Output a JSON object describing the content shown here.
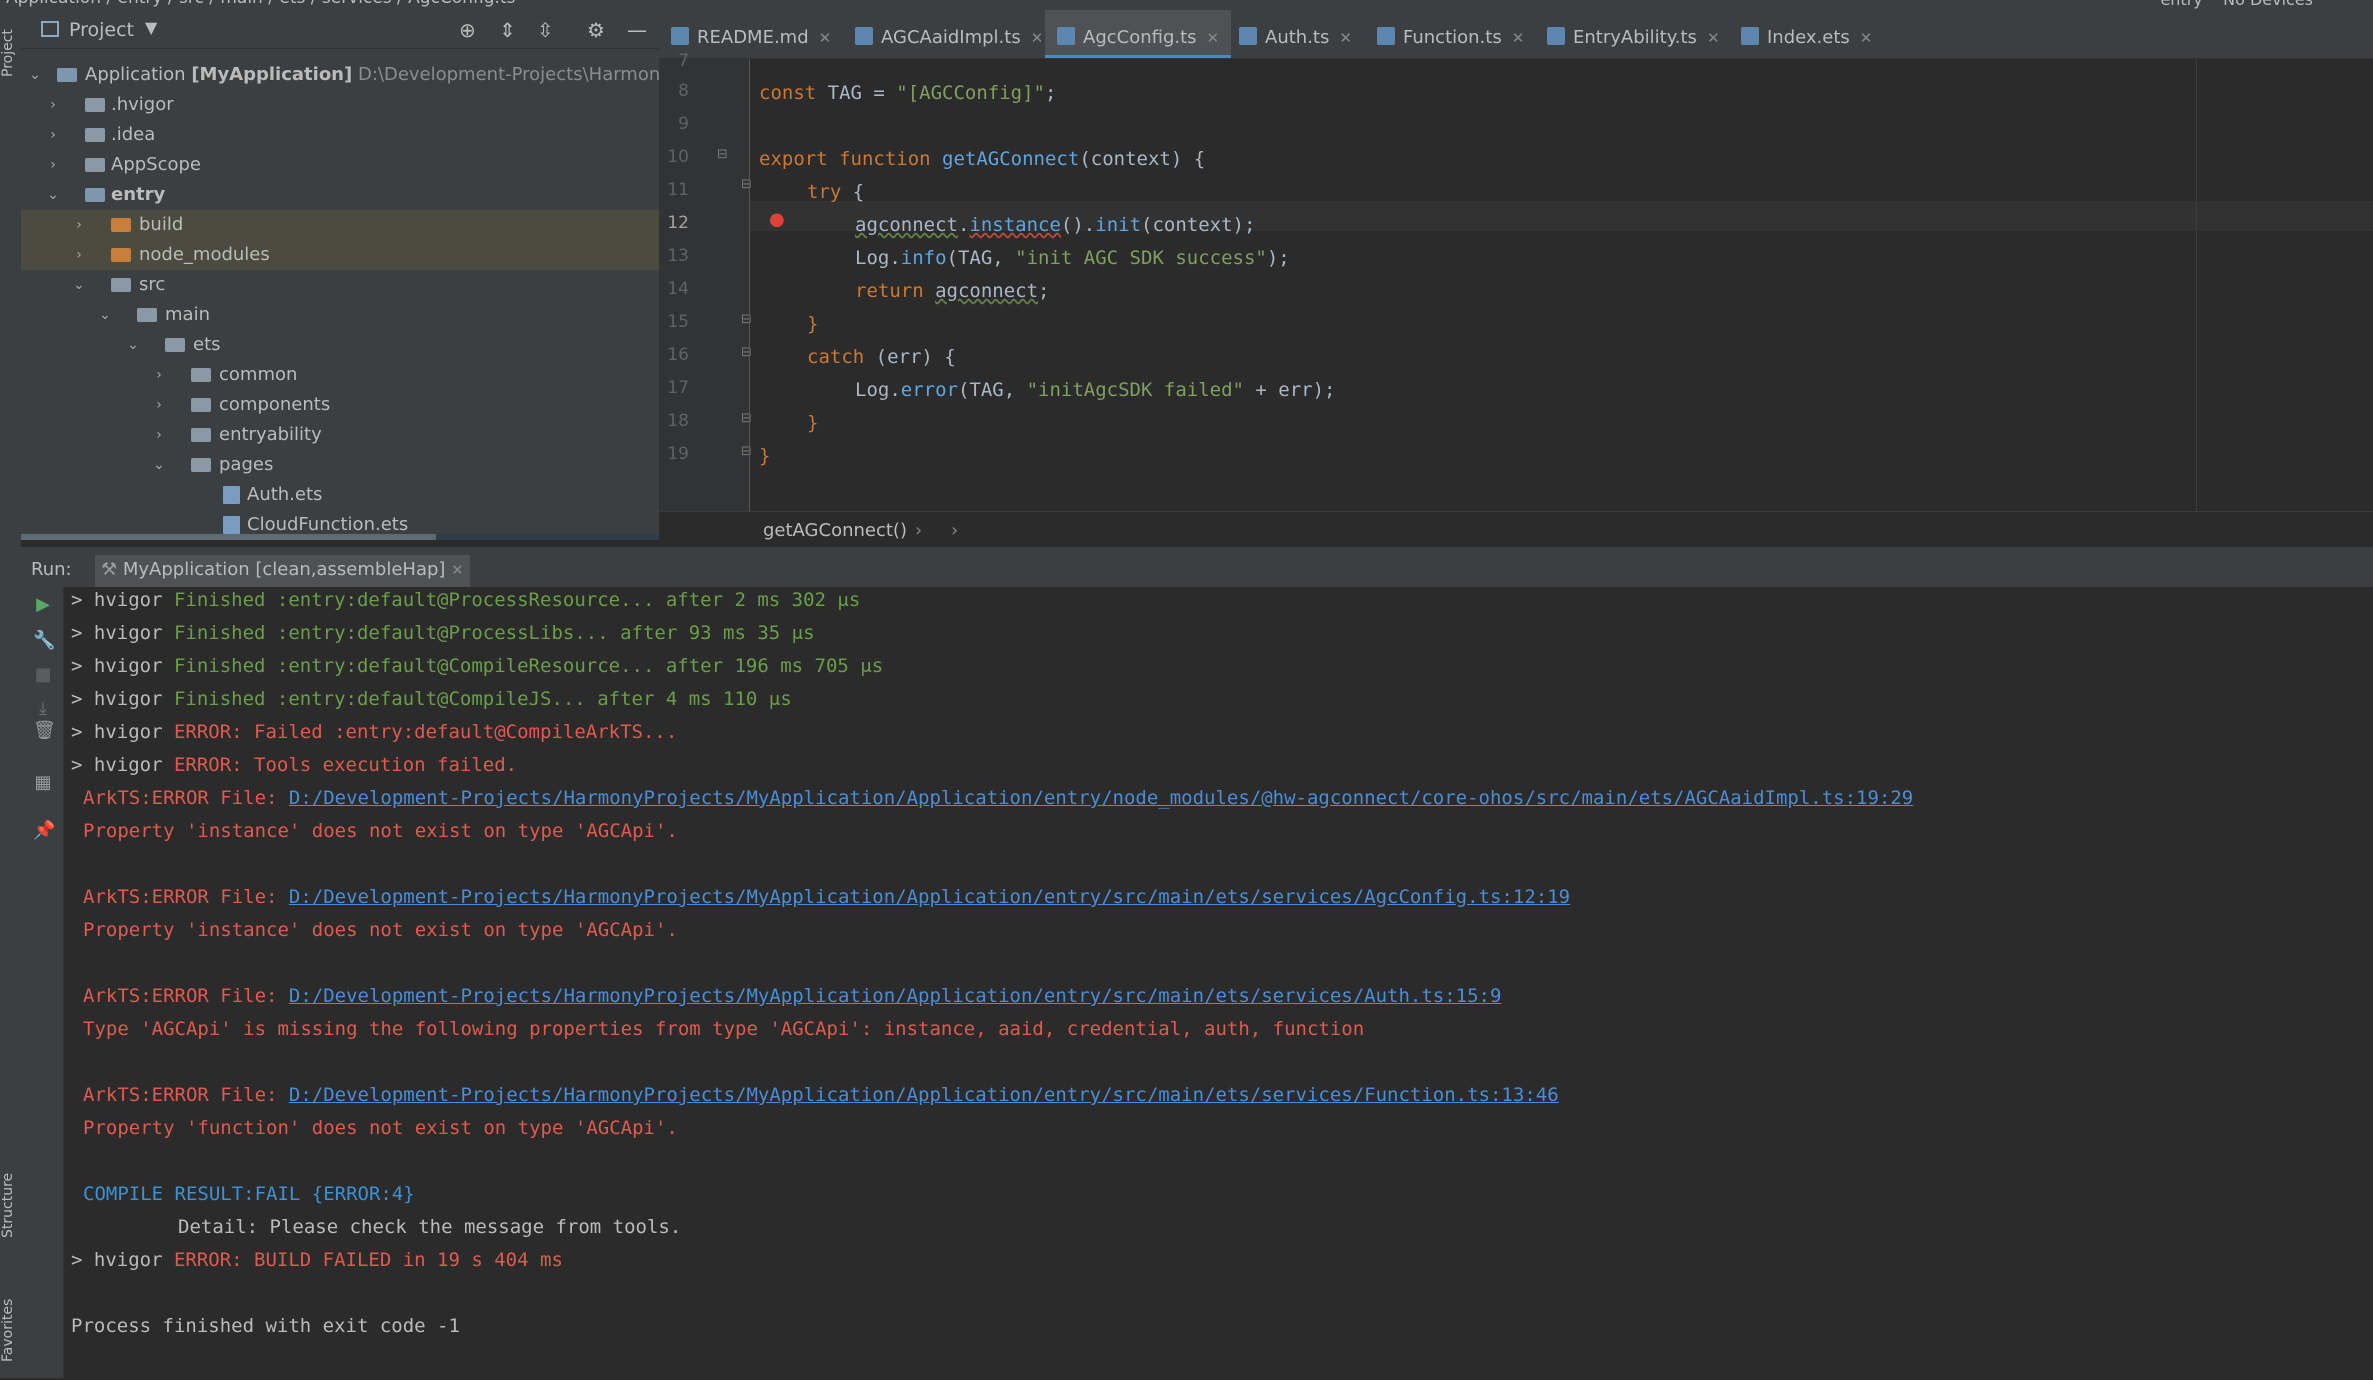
{
  "topbar": {
    "breadcrumb": "Application / entry / src / main / ets / services / AgcConfig.ts",
    "run_config": "entry",
    "device": "No Devices"
  },
  "left_stripe": {
    "project": "Project",
    "structure": "Structure",
    "favorites": "Favorites"
  },
  "project_panel": {
    "title": "Project",
    "tree": [
      {
        "label": "Application",
        "bold": "[MyApplication]",
        "path": "D:\\Development-Projects\\HarmonyPr"
      },
      {
        "label": ".hvigor"
      },
      {
        "label": ".idea"
      },
      {
        "label": "AppScope"
      },
      {
        "label": "entry"
      },
      {
        "label": "build"
      },
      {
        "label": "node_modules"
      },
      {
        "label": "src"
      },
      {
        "label": "main"
      },
      {
        "label": "ets"
      },
      {
        "label": "common"
      },
      {
        "label": "components"
      },
      {
        "label": "entryability"
      },
      {
        "label": "pages"
      },
      {
        "label": "Auth.ets"
      },
      {
        "label": "CloudFunction.ets"
      }
    ]
  },
  "tabs": [
    {
      "label": "README.md"
    },
    {
      "label": "AGCAaidImpl.ts"
    },
    {
      "label": "AgcConfig.ts"
    },
    {
      "label": "Auth.ts"
    },
    {
      "label": "Function.ts"
    },
    {
      "label": "EntryAbility.ts"
    },
    {
      "label": "Index.ets"
    }
  ],
  "editor": {
    "line_numbers": [
      "7",
      "8",
      "9",
      "10",
      "11",
      "12",
      "13",
      "14",
      "15",
      "16",
      "17",
      "18",
      "19"
    ],
    "breadcrumb": "getAGConnect()",
    "code": {
      "l8_kw": "const",
      "l8_a": " TAG = ",
      "l8_str": "\"[AGCConfig]\"",
      "l8_b": ";",
      "l10_kw": "export function",
      "l10_fn": "getAGConnect",
      "l10_b": "(context) {",
      "l11_kw": "try",
      "l11_b": " {",
      "l12_a": "agconnect",
      "l12_b": ".",
      "l12_c": "instance",
      "l12_d": "().",
      "l12_e": "init",
      "l12_f": "(context);",
      "l13_a": "Log.",
      "l13_b": "info",
      "l13_c": "(TAG, ",
      "l13_str": "\"init AGC SDK success\"",
      "l13_d": ");",
      "l14_kw": "return",
      "l14_a": "agconnect",
      "l14_b": ";",
      "l15": "}",
      "l16_kw": "catch",
      "l16_b": " (err) {",
      "l17_a": "Log.",
      "l17_b": "error",
      "l17_c": "(TAG, ",
      "l17_str": "\"initAgcSDK failed\"",
      "l17_d": " + err);",
      "l18": "}",
      "l19": "}"
    }
  },
  "run": {
    "label": "Run:",
    "tab": "MyApplication [clean,assembleHap]",
    "lines": {
      "l1_a": "> hvigor ",
      "l1_b": "Finished :entry:default@ProcessResource... after 2 ms 302 μs",
      "l2_a": "> hvigor ",
      "l2_b": "Finished :entry:default@ProcessLibs... after 93 ms 35 μs",
      "l3_a": "> hvigor ",
      "l3_b": "Finished :entry:default@CompileResource... after 196 ms 705 μs",
      "l4_a": "> hvigor ",
      "l4_b": "Finished :entry:default@CompileJS... after 4 ms 110 μs",
      "l5_a": "> hvigor ",
      "l5_b": "ERROR: Failed :entry:default@CompileArkTS...",
      "l6_a": "> hvigor ",
      "l6_b": "ERROR: Tools execution failed.",
      "e1_pre": "ArkTS:ERROR File: ",
      "e1_link": "D:/Development-Projects/HarmonyProjects/MyApplication/Application/entry/node_modules/@hw-agconnect/core-ohos/src/main/ets/AGCAaidImpl.ts:19:29",
      "e1_msg": "Property 'instance' does not exist on type 'AGCApi'.",
      "e2_pre": "ArkTS:ERROR File: ",
      "e2_link": "D:/Development-Projects/HarmonyProjects/MyApplication/Application/entry/src/main/ets/services/AgcConfig.ts:12:19",
      "e2_msg": "Property 'instance' does not exist on type 'AGCApi'.",
      "e3_pre": "ArkTS:ERROR File: ",
      "e3_link": "D:/Development-Projects/HarmonyProjects/MyApplication/Application/entry/src/main/ets/services/Auth.ts:15:9",
      "e3_msg": "Type 'AGCApi' is missing the following properties from type 'AGCApi': instance, aaid, credential, auth, function",
      "e4_pre": "ArkTS:ERROR File: ",
      "e4_link": "D:/Development-Projects/HarmonyProjects/MyApplication/Application/entry/src/main/ets/services/Function.ts:13:46",
      "e4_msg": "Property 'function' does not exist on type 'AGCApi'.",
      "compile": "COMPILE RESULT:FAIL {ERROR:4}",
      "detail": "Detail: Please check the message from tools.",
      "fail_a": "> hvigor ",
      "fail_b": "ERROR: BUILD FAILED in 19 s 404 ms",
      "exit": "Process finished with exit code -1"
    }
  },
  "colors": {
    "accent": "#4a88c7",
    "error": "#e05a4f",
    "success": "#6a9e48",
    "link": "#4a8dd9"
  }
}
